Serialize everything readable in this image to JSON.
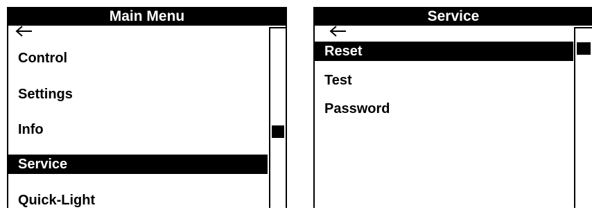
{
  "main_menu": {
    "title": "Main Menu",
    "back_icon": "left-arrow-icon",
    "items": [
      {
        "label": "Control",
        "selected": false
      },
      {
        "label": "Settings",
        "selected": false
      },
      {
        "label": "Info",
        "selected": false
      },
      {
        "label": "Service",
        "selected": true
      },
      {
        "label": "Quick-Light",
        "selected": false
      }
    ]
  },
  "service_menu": {
    "title": "Service",
    "back_icon": "left-arrow-icon",
    "items": [
      {
        "label": "Reset",
        "selected": true
      },
      {
        "label": "Test",
        "selected": false
      },
      {
        "label": "Password",
        "selected": false
      }
    ]
  },
  "colors": {
    "foreground": "#000000",
    "background": "#ffffff"
  }
}
